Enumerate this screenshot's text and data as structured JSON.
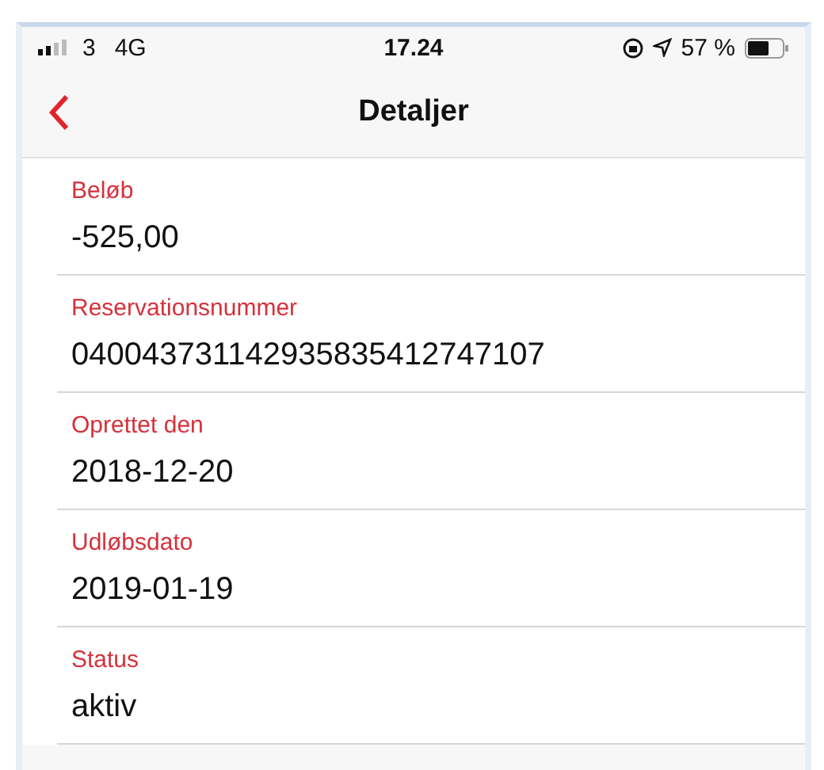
{
  "status_bar": {
    "carrier": "3",
    "network": "4G",
    "time": "17.24",
    "battery": "57 %"
  },
  "nav": {
    "title": "Detaljer"
  },
  "fields": [
    {
      "label": "Beløb",
      "value": "-525,00"
    },
    {
      "label": "Reservationsnummer",
      "value": "040043731142935835412747107"
    },
    {
      "label": "Oprettet den",
      "value": "2018-12-20"
    },
    {
      "label": "Udløbsdato",
      "value": "2019-01-19"
    },
    {
      "label": "Status",
      "value": "aktiv"
    }
  ]
}
